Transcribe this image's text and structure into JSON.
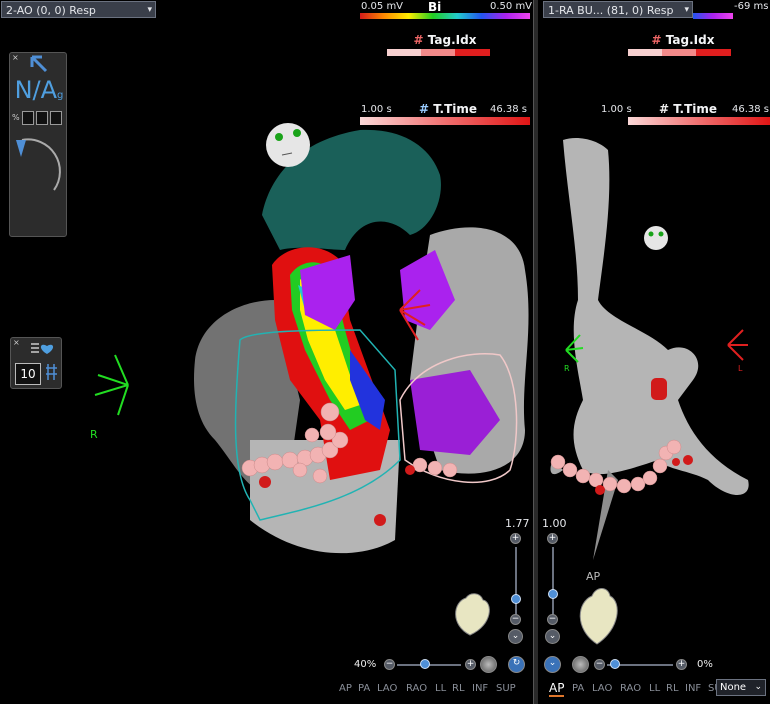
{
  "left_view": {
    "dropdown": "2-AO (0, 0) Resp",
    "voltage_min": "0.05 mV",
    "voltage_label": "Bi",
    "voltage_max": "0.50 mV",
    "tag_label": "Tag.Idx",
    "time_min": "1.00 s",
    "time_label": "T.Time",
    "time_max": "46.38 s",
    "tool_panel": {
      "close": "×",
      "mode_text": "N/A",
      "mode_sub": "g",
      "pct_icon": "%"
    },
    "beat_panel": {
      "close": "×",
      "value": "10"
    },
    "axis_label": "R",
    "slider_top_value": "1.77",
    "zoom_value": "40%",
    "views": [
      "AP",
      "PA",
      "LAO",
      "RAO",
      "LL",
      "RL",
      "INF",
      "SUP"
    ],
    "active_view": ""
  },
  "right_view": {
    "dropdown": "1-RA BU... (81, 0) Resp",
    "timing_value": "-69 ms",
    "tag_label": "Tag.Idx",
    "time_min": "1.00 s",
    "time_label": "T.Time",
    "time_max": "46.38 s",
    "axis_label": "R",
    "axis_label_right": "L",
    "slider_top_value": "1.00",
    "orientation_label": "AP",
    "zoom_value": "0%",
    "views": [
      "AP",
      "PA",
      "LAO",
      "RAO",
      "LL",
      "RL",
      "INF",
      "SU"
    ],
    "active_view": "AP",
    "select_value": "None"
  },
  "colors": {
    "mesh_gray": "#b5b5b5",
    "teal_chamber": "#1d6a63",
    "lesion_pink": "#f2b3b3",
    "lesion_red": "#d11a1a",
    "accent_blue": "#4f8fd6",
    "axis_green": "#22dd22",
    "axis_red": "#e02020"
  }
}
